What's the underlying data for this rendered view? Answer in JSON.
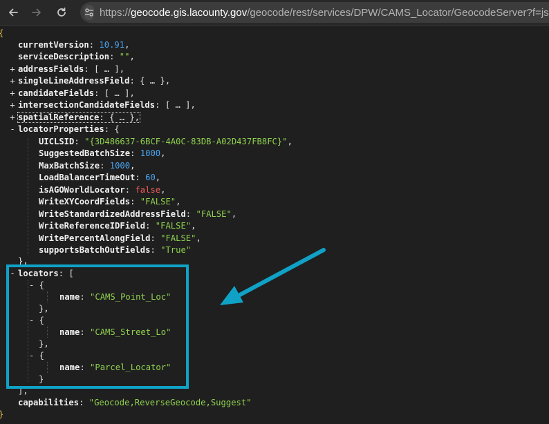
{
  "browser": {
    "url_scheme": "https://",
    "url_host": "geocode.gis.lacounty.gov",
    "url_path": "/geocode/rest/services/DPW/CAMS_Locator/GeocodeServer?f=json"
  },
  "json": {
    "open_brace": "{",
    "close_brace": "}",
    "currentVersion": {
      "key": "currentVersion",
      "value": "10.91"
    },
    "serviceDescription": {
      "key": "serviceDescription",
      "value": "\"\""
    },
    "collapsed": [
      {
        "key": "addressFields",
        "summary": "[ … ]"
      },
      {
        "key": "singleLineAddressField",
        "summary": "{ … }"
      },
      {
        "key": "candidateFields",
        "summary": "[ … ]"
      },
      {
        "key": "intersectionCandidateFields",
        "summary": "[ … ]"
      },
      {
        "key": "spatialReference",
        "summary": "{ … }"
      }
    ],
    "locatorProperties": {
      "key": "locatorProperties",
      "items": [
        {
          "key": "UICLSID",
          "value": "\"{3D486637-6BCF-4A0C-83DB-A02D437FB8FC}\""
        },
        {
          "key": "SuggestedBatchSize",
          "value": "1000"
        },
        {
          "key": "MaxBatchSize",
          "value": "1000"
        },
        {
          "key": "LoadBalancerTimeOut",
          "value": "60"
        },
        {
          "key": "isAGOWorldLocator",
          "value": "false"
        },
        {
          "key": "WriteXYCoordFields",
          "value": "\"FALSE\""
        },
        {
          "key": "WriteStandardizedAddressField",
          "value": "\"FALSE\""
        },
        {
          "key": "WriteReferenceIDField",
          "value": "\"FALSE\""
        },
        {
          "key": "WritePercentAlongField",
          "value": "\"FALSE\""
        },
        {
          "key": "supportsBatchOutFields",
          "value": "\"True\""
        }
      ]
    },
    "locators": {
      "key": "locators",
      "items": [
        {
          "key": "name",
          "value": "\"CAMS_Point_Loc\""
        },
        {
          "key": "name",
          "value": "\"CAMS_Street_Lo\""
        },
        {
          "key": "name",
          "value": "\"Parcel_Locator\""
        }
      ]
    },
    "capabilities": {
      "key": "capabilities",
      "value": "\"Geocode,ReverseGeocode,Suggest\""
    }
  },
  "colors": {
    "annotation": "#10a2c6",
    "string": "#8fd14f",
    "number": "#4aa3f0",
    "boolean": "#ef5b5b"
  },
  "icons": [
    "back-arrow-icon",
    "forward-arrow-icon",
    "reload-icon",
    "site-settings-icon"
  ]
}
